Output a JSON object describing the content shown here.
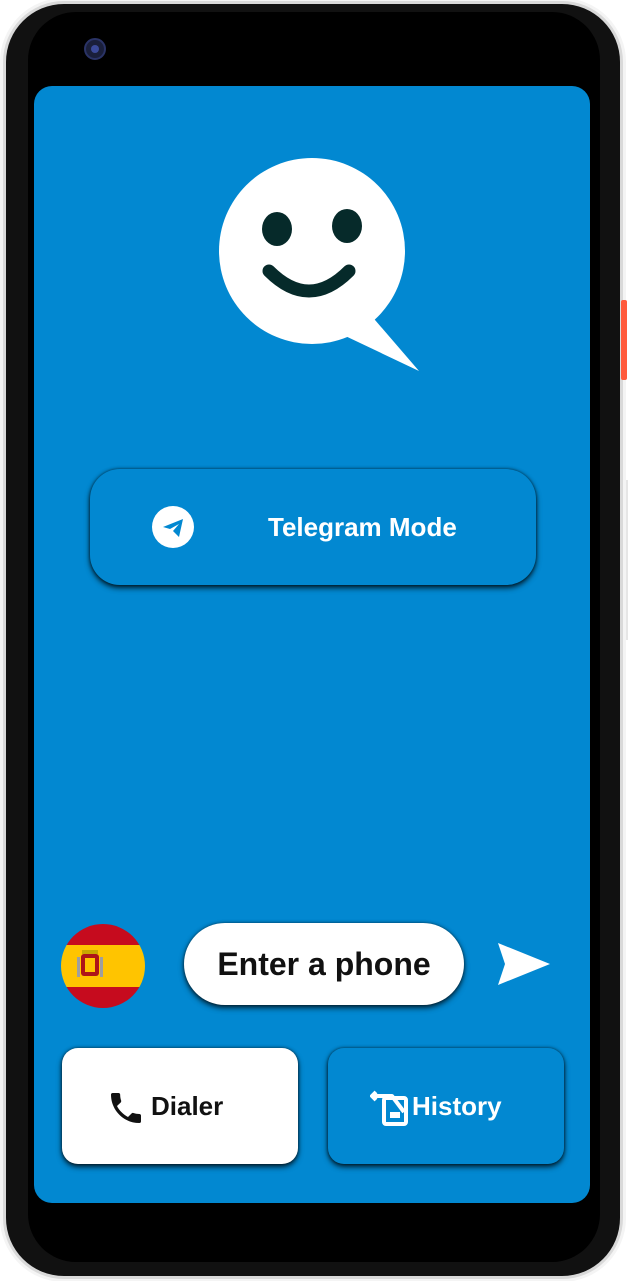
{
  "app": {
    "accent_color": "#0288D1",
    "logo_icon": "smiley-chat-bubble-icon"
  },
  "mode_button": {
    "label": "Telegram Mode",
    "icon": "telegram-icon"
  },
  "phone_entry": {
    "country_flag": "spain-flag-icon",
    "placeholder": "Enter a phone",
    "send_icon": "send-icon"
  },
  "bottom_nav": {
    "dialer_label": "Dialer",
    "dialer_icon": "phone-icon",
    "history_label": "History",
    "history_icon": "history-icon"
  }
}
